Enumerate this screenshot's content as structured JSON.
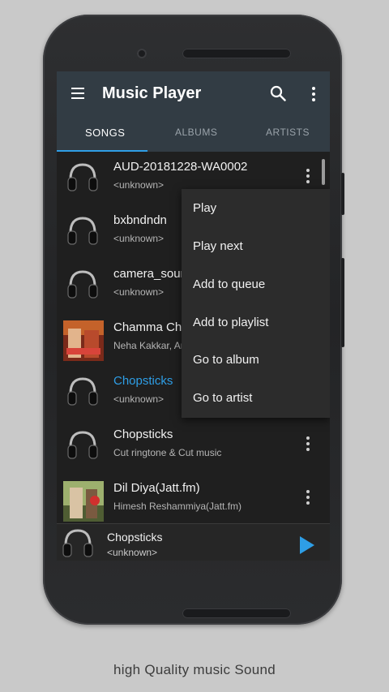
{
  "app": {
    "title": "Music Player"
  },
  "tabs": [
    {
      "label": "SONGS"
    },
    {
      "label": "ALBUMS"
    },
    {
      "label": "ARTISTS"
    }
  ],
  "songs": [
    {
      "title": "AUD-20181228-WA0002",
      "subtitle": "<unknown>",
      "thumb": "headphones"
    },
    {
      "title": "bxbndndn",
      "subtitle": "<unknown>",
      "thumb": "headphones"
    },
    {
      "title": "camera_sour",
      "subtitle": "<unknown>",
      "thumb": "headphones"
    },
    {
      "title": "Chamma Ch",
      "subtitle": "Neha Kakkar, Ar",
      "thumb": "album-art"
    },
    {
      "title": "Chopsticks",
      "subtitle": "<unknown>",
      "thumb": "headphones",
      "playing": true
    },
    {
      "title": "Chopsticks",
      "subtitle": "Cut ringtone & Cut music",
      "thumb": "headphones"
    },
    {
      "title": "Dil Diya(Jatt.fm)",
      "subtitle": "Himesh Reshammiya(Jatt.fm)",
      "thumb": "album-art"
    }
  ],
  "popup_menu": {
    "items": [
      {
        "label": "Play"
      },
      {
        "label": "Play next"
      },
      {
        "label": "Add to queue"
      },
      {
        "label": "Add to playlist"
      },
      {
        "label": "Go to album"
      },
      {
        "label": "Go to artist"
      }
    ]
  },
  "now_playing": {
    "title": "Chopsticks",
    "subtitle": "<unknown>"
  },
  "tagline": "high Quality music Sound",
  "colors": {
    "accent": "#2e9ee6",
    "appbar": "#323c44",
    "list_bg": "#1f1f1f"
  }
}
